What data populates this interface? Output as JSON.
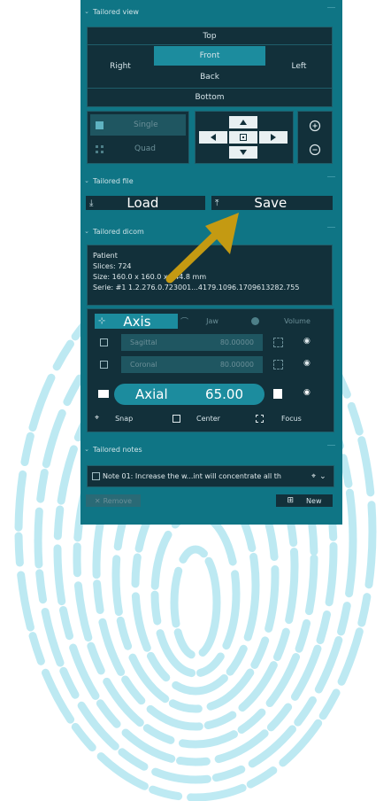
{
  "colors": {
    "panel": "#0f7585",
    "dark": "#12303a",
    "accent": "#1c8c9e",
    "arrow": "#c49a12",
    "fingerprint": "#4fc3d9"
  },
  "tailored_view": {
    "header": "Tailored view",
    "views": {
      "top": "Top",
      "front": "Front",
      "right": "Right",
      "left": "Left",
      "back": "Back",
      "bottom": "Bottom"
    },
    "layout": {
      "single": "Single",
      "quad": "Quad"
    },
    "nav_icons": [
      "arrow-up-icon",
      "arrow-left-icon",
      "center-icon",
      "arrow-right-icon",
      "arrow-down-icon"
    ],
    "zoom_icons": [
      "zoom-in-icon",
      "zoom-out-icon"
    ]
  },
  "tailored_file": {
    "header": "Tailored file",
    "load": "Load",
    "save": "Save"
  },
  "tailored_dicom": {
    "header": "Tailored dicom",
    "info": {
      "patient": "Patient",
      "slices": "Slices: 724",
      "size": "Size: 160.0 x 160.0 x 144.8 mm",
      "serie": "Serie: #1 1.2.276.0.723001...4179.1096.1709613282.755"
    },
    "tabs": {
      "axis": "Axis",
      "jaw": "Jaw",
      "volume": "Volume"
    },
    "planes": [
      {
        "name": "Sagittal",
        "value": "80.00000"
      },
      {
        "name": "Coronal",
        "value": "80.00000"
      }
    ],
    "axial": {
      "name": "Axial",
      "value": "65.00"
    },
    "actions": {
      "snap": "Snap",
      "center": "Center",
      "focus": "Focus"
    }
  },
  "tailored_notes": {
    "header": "Tailored notes",
    "note": "Note 01: Increase the w...int will concentrate all th",
    "remove": "Remove",
    "new": "New"
  }
}
